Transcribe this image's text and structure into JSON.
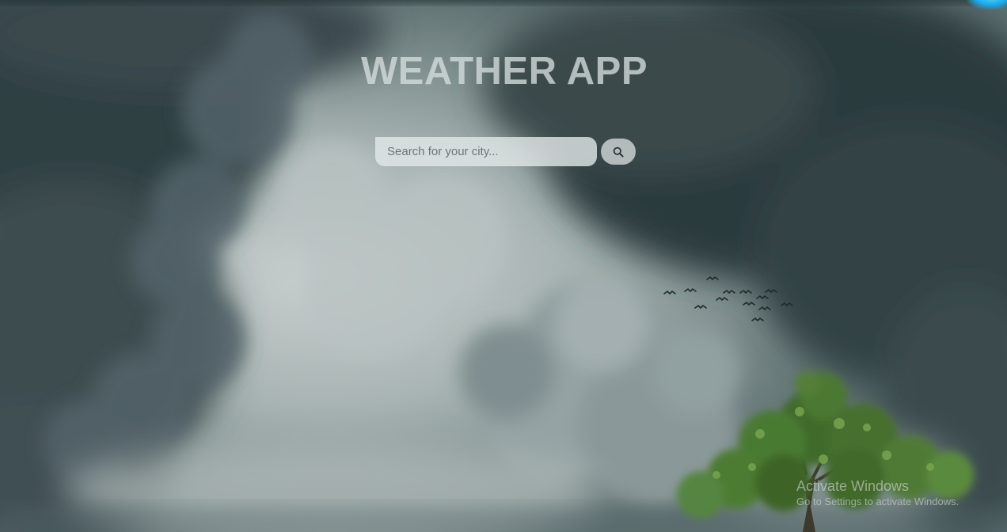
{
  "header": {
    "title": "WEATHER APP"
  },
  "search": {
    "placeholder": "Search for your city...",
    "value": "",
    "button_icon": "search-icon"
  },
  "background": {
    "scene": "stormy-cloudy-sky-with-birds-and-tree"
  },
  "watermark": {
    "title": "Activate Windows",
    "subtitle": "Go to Settings to activate Windows."
  },
  "colors": {
    "accent_glow": "#1aa7e6",
    "title_text": "#d6dede",
    "tree_green": "#4f7a34"
  }
}
